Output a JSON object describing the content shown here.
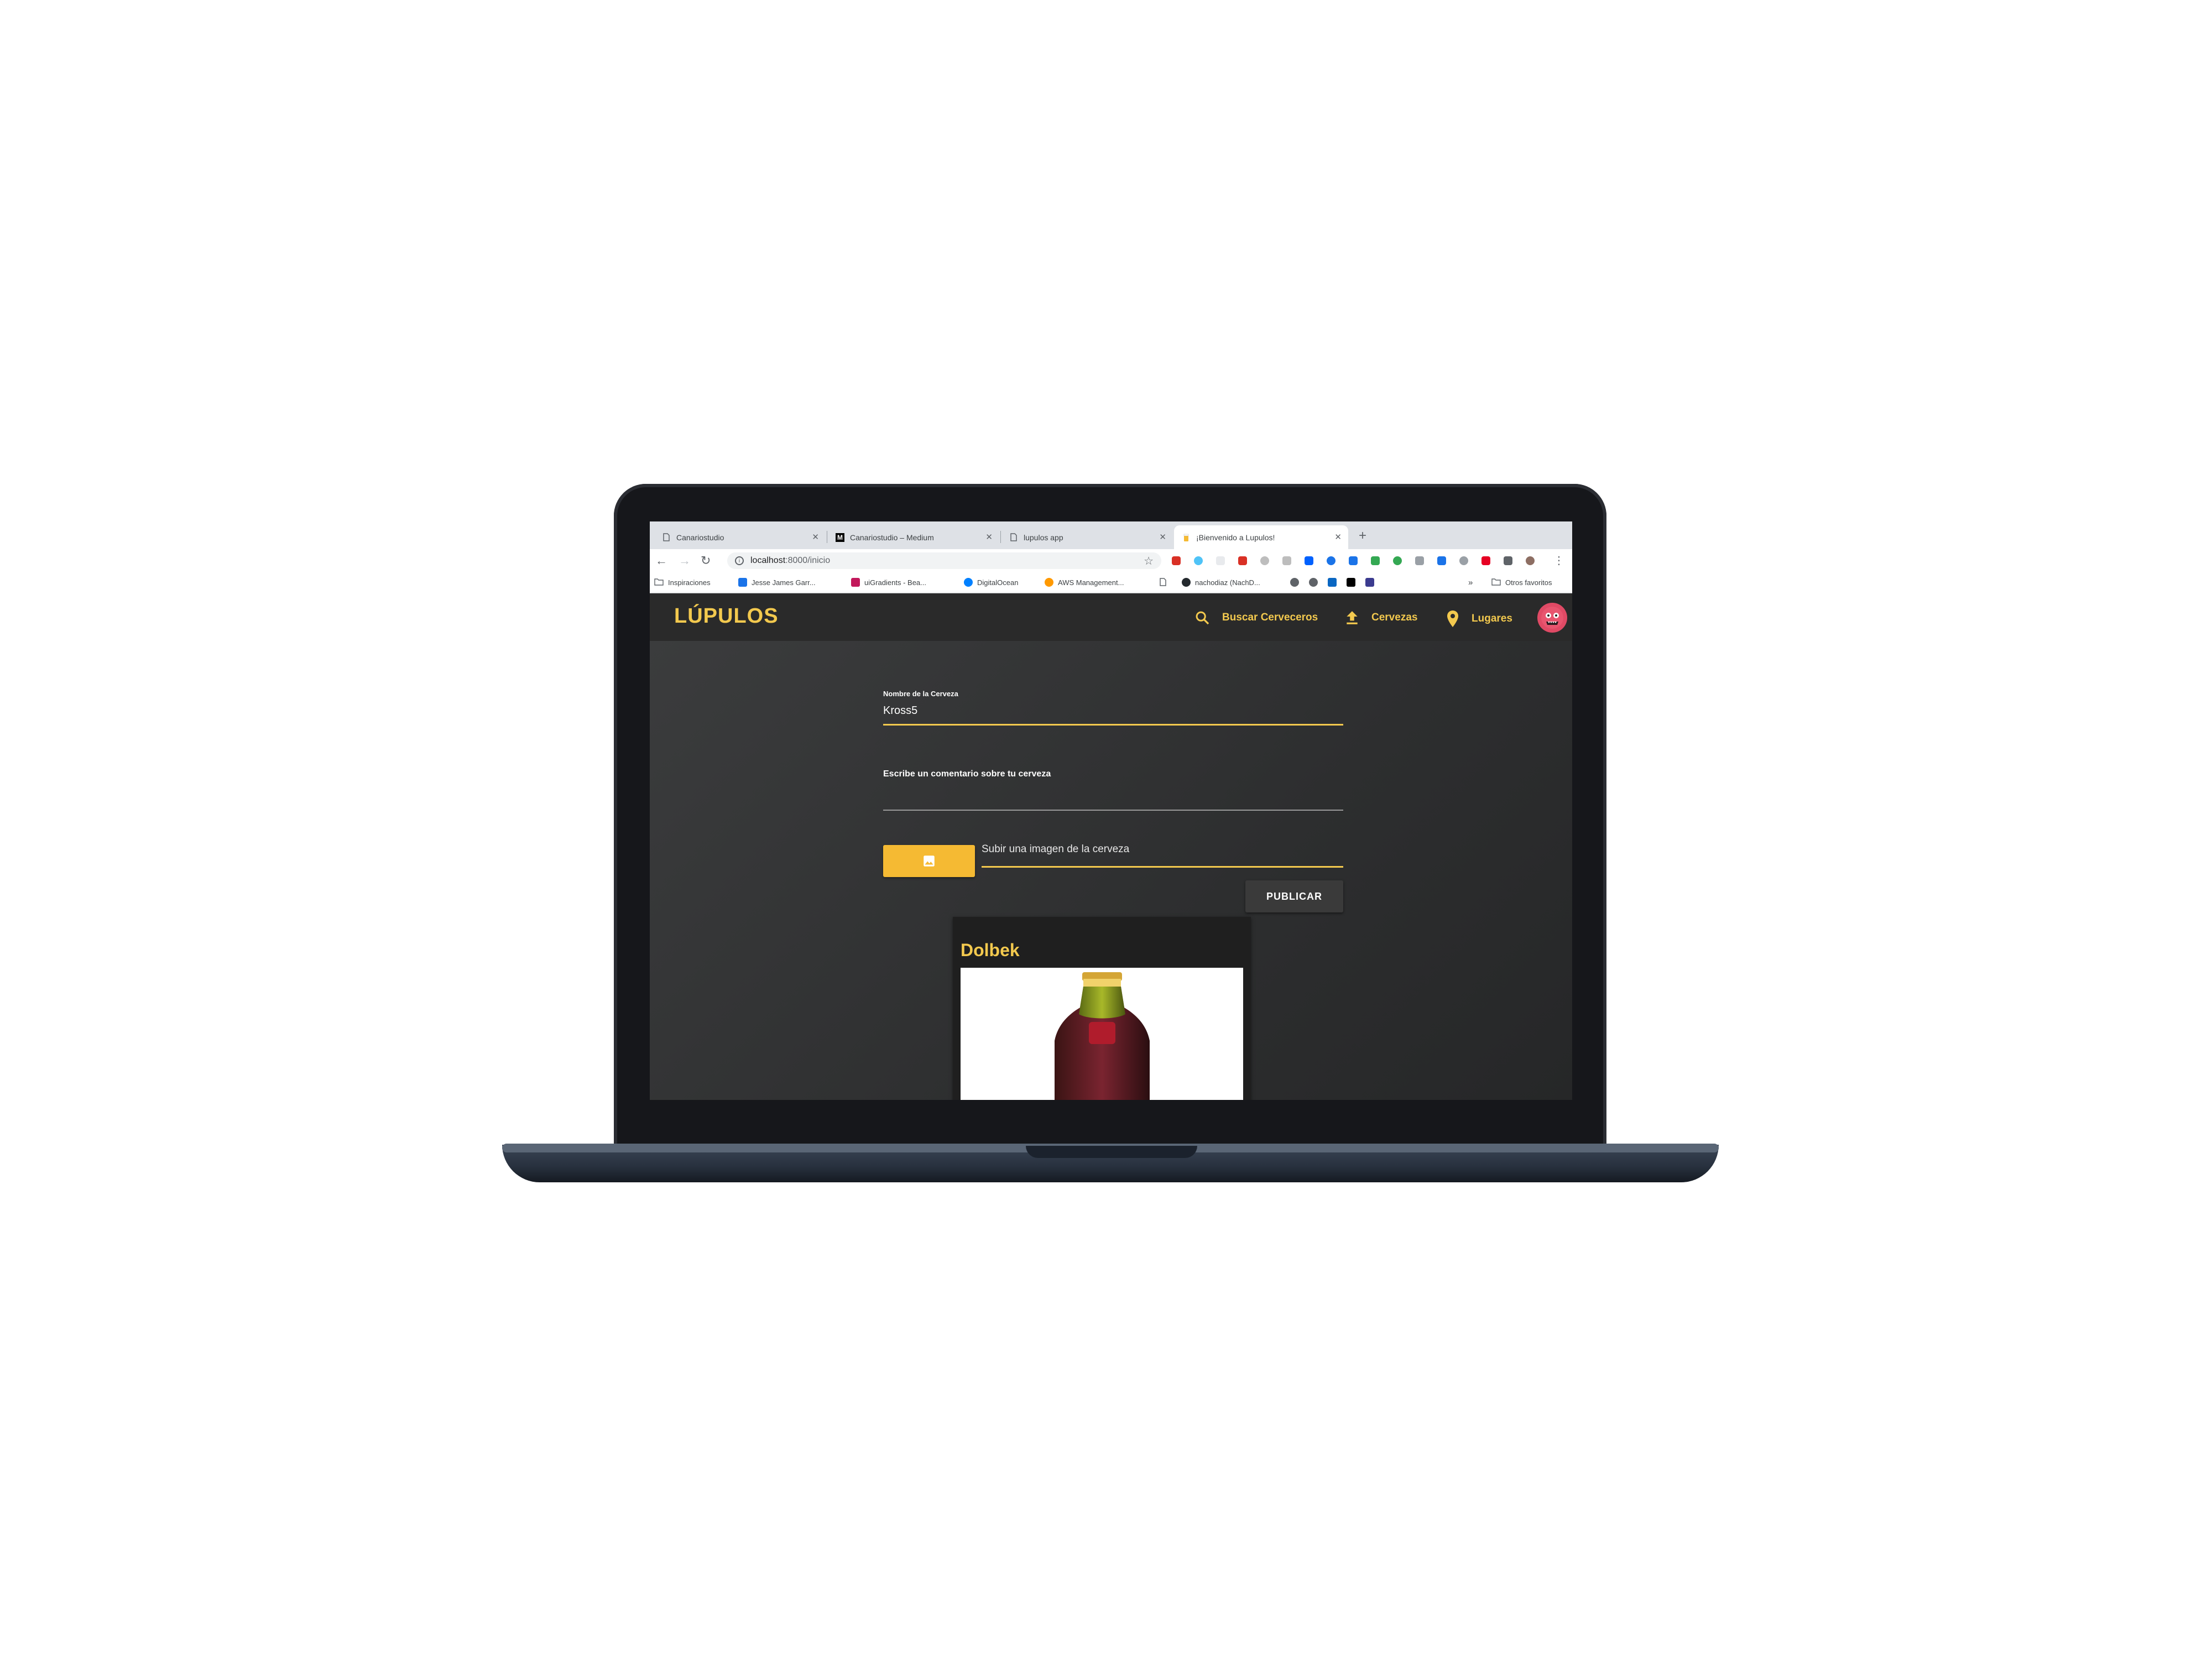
{
  "browser": {
    "tabs": [
      {
        "title": "Canariostudio",
        "favicon": "page-icon",
        "active": false
      },
      {
        "title": "Canariostudio – Medium",
        "favicon": "medium-icon",
        "active": false
      },
      {
        "title": "lupulos app",
        "favicon": "page-icon",
        "active": false
      },
      {
        "title": "¡Bienvenido a Lupulos!",
        "favicon": "beer-icon",
        "active": true
      }
    ],
    "new_tab": "+",
    "url_host": "localhost",
    "url_rest": ":8000/inicio",
    "bookmarks": [
      {
        "label": "Inspiraciones",
        "icon": "folder-icon"
      },
      {
        "label": "Jesse James Garr...",
        "icon": "site-icon",
        "color": "#1a73e8"
      },
      {
        "label": "uiGradients - Bea...",
        "icon": "site-icon",
        "color": "#c2185b"
      },
      {
        "label": "DigitalOcean",
        "icon": "site-icon",
        "color": "#0080ff"
      },
      {
        "label": "AWS Management...",
        "icon": "site-icon",
        "color": "#ff9900"
      },
      {
        "label": "",
        "icon": "page-icon"
      },
      {
        "label": "nachodiaz (NachD...",
        "icon": "github-icon",
        "color": "#24292e"
      }
    ],
    "bookmarks_overflow": "»",
    "other_bookmarks": "Otros favoritos",
    "extension_colors": [
      "#d93025",
      "#4fc3f7",
      "#e8eaed",
      "#d93025",
      "#bdbdbd",
      "#bdbdbd",
      "#0061fe",
      "#1a73e8",
      "#1a73e8",
      "#34a853",
      "#34a853",
      "#9aa0a6",
      "#1a73e8",
      "#9aa0a6",
      "#e60023",
      "#5f6368",
      "#8d6e63"
    ]
  },
  "app": {
    "logo": "LÚPULOS",
    "nav": [
      {
        "label": "Buscar Cerveceros",
        "icon": "search-icon"
      },
      {
        "label": "Cervezas",
        "icon": "upload-icon"
      },
      {
        "label": "Lugares",
        "icon": "location-pin-icon"
      }
    ],
    "accent_color": "#f3c94e",
    "button_color": "#f5ba33"
  },
  "form": {
    "name_label": "Nombre de la Cerveza",
    "name_value": "Kross5",
    "comment_placeholder": "Escribe un comentario sobre tu cerveza",
    "upload_label": "Subir una imagen de la cerveza",
    "upload_icon": "image-icon",
    "publish_label": "PUBLICAR"
  },
  "posts": [
    {
      "title": "Dolbek"
    }
  ]
}
